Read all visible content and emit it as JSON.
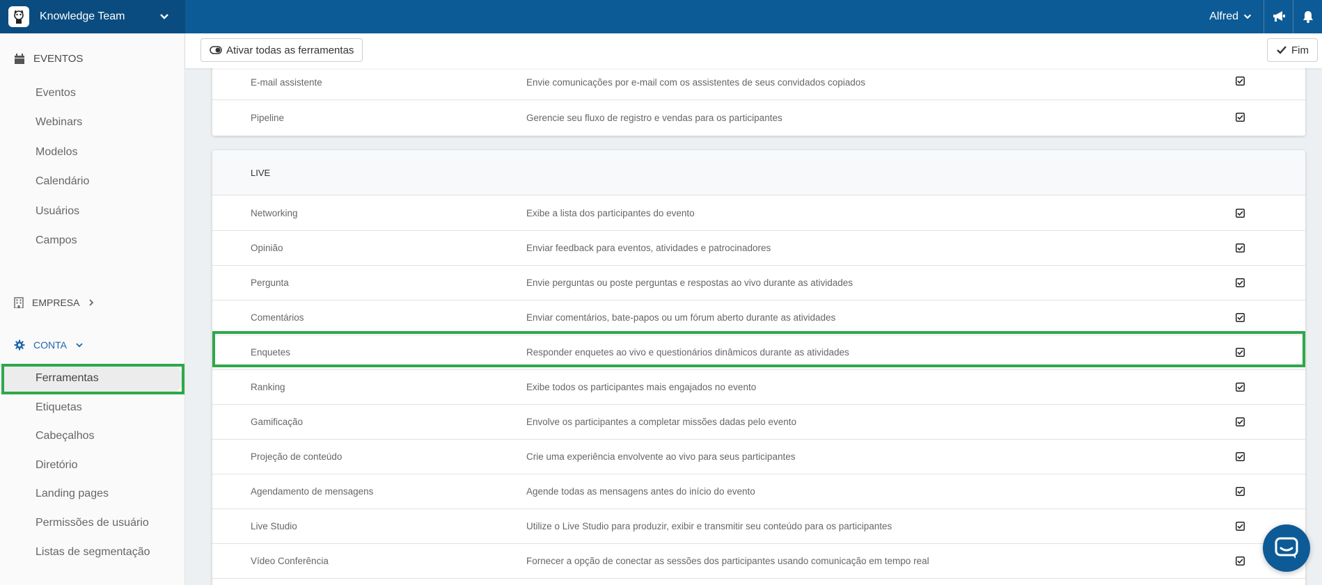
{
  "header": {
    "brand": "Knowledge Team",
    "user": "Alfred"
  },
  "sidebar": {
    "eventos": {
      "title": "EVENTOS",
      "items": [
        "Eventos",
        "Webinars",
        "Modelos",
        "Calendário",
        "Usuários",
        "Campos"
      ]
    },
    "empresa": {
      "title": "EMPRESA"
    },
    "conta": {
      "title": "CONTA",
      "items": [
        "Ferramentas",
        "Etiquetas",
        "Cabeçalhos",
        "Diretório",
        "Landing pages",
        "Permissões de usuário",
        "Listas de segmentação"
      ],
      "active": "Ferramentas"
    }
  },
  "toolbar": {
    "activate_all": "Ativar todas as ferramentas",
    "finish": "Fim"
  },
  "tools_top": [
    {
      "name": "E-mail assistente",
      "desc": "Envie comunicações por e-mail com os assistentes de seus convidados copiados",
      "checked": true
    },
    {
      "name": "Pipeline",
      "desc": "Gerencie seu fluxo de registro e vendas para os participantes",
      "checked": true
    }
  ],
  "live": {
    "title": "LIVE",
    "tools": [
      {
        "name": "Networking",
        "desc": "Exibe a lista dos participantes do evento",
        "checked": true
      },
      {
        "name": "Opinião",
        "desc": "Enviar feedback para eventos, atividades e patrocinadores",
        "checked": true
      },
      {
        "name": "Pergunta",
        "desc": "Envie perguntas ou poste perguntas e respostas ao vivo durante as atividades",
        "checked": true
      },
      {
        "name": "Comentários",
        "desc": "Enviar comentários, bate-papos ou um fórum aberto durante as atividades",
        "checked": true
      },
      {
        "name": "Enquetes",
        "desc": "Responder enquetes ao vivo e questionários dinâmicos durante as atividades",
        "checked": true
      },
      {
        "name": "Ranking",
        "desc": "Exibe todos os participantes mais engajados no evento",
        "checked": true
      },
      {
        "name": "Gamificação",
        "desc": "Envolve os participantes a completar missões dadas pelo evento",
        "checked": true
      },
      {
        "name": "Projeção de conteúdo",
        "desc": "Crie uma experiência envolvente ao vivo para seus participantes",
        "checked": true
      },
      {
        "name": "Agendamento de mensagens",
        "desc": "Agende todas as mensagens antes do início do evento",
        "checked": true
      },
      {
        "name": "Live Studio",
        "desc": "Utilize o Live Studio para produzir, exibir e transmitir seu conteúdo para os participantes",
        "checked": true
      },
      {
        "name": "Vídeo Conferência",
        "desc": "Fornecer a opção de conectar as sessões dos participantes usando comunicação em tempo real",
        "checked": true
      }
    ],
    "highlighted": "Enquetes"
  },
  "icons": {
    "calendar": "calendar-icon",
    "building": "building-icon",
    "gear": "gear-icon",
    "megaphone": "megaphone-icon",
    "bell": "bell-icon",
    "toggle": "toggle-icon",
    "check": "check-icon",
    "chat": "chat-icon"
  },
  "colors": {
    "topbar": "#0d5b96",
    "brand_bg": "#0a4c7f",
    "highlight": "#2ea84a",
    "accent": "#1f64a8"
  }
}
